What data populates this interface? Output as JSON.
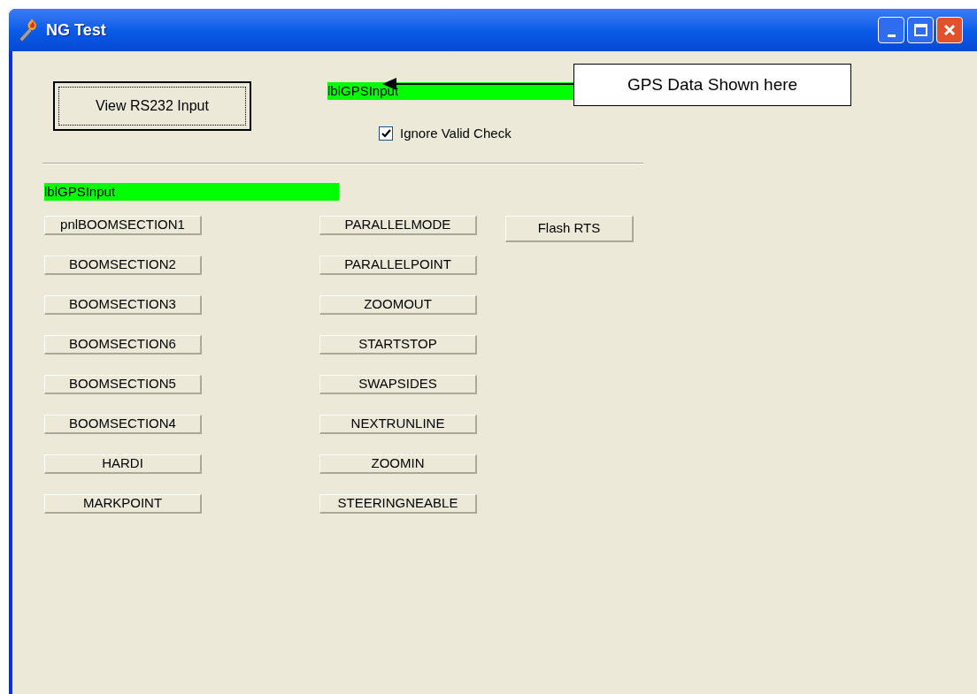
{
  "window": {
    "title": "NG Test"
  },
  "view_button": {
    "label": "View RS232 Input",
    "focused": true
  },
  "top_label": {
    "text": "lblGPSInput"
  },
  "ignore_check": {
    "label": "Ignore Valid Check",
    "checked": true
  },
  "gps_label": {
    "text": "lblGPSInput"
  },
  "column_1": [
    "pnlBOOMSECTION1",
    "BOOMSECTION2",
    "BOOMSECTION3",
    "BOOMSECTION6",
    "BOOMSECTION5",
    "BOOMSECTION4",
    "HARDI",
    "MARKPOINT"
  ],
  "column_2": [
    "PARALLELMODE",
    "PARALLELPOINT",
    "ZOOMOUT",
    "STARTSTOP",
    "SWAPSIDES",
    "NEXTRUNLINE",
    "ZOOMIN",
    "STEERINGNEABLE"
  ],
  "flash_button": {
    "label": "Flash RTS"
  },
  "callout": {
    "text": "GPS Data Shown here"
  }
}
